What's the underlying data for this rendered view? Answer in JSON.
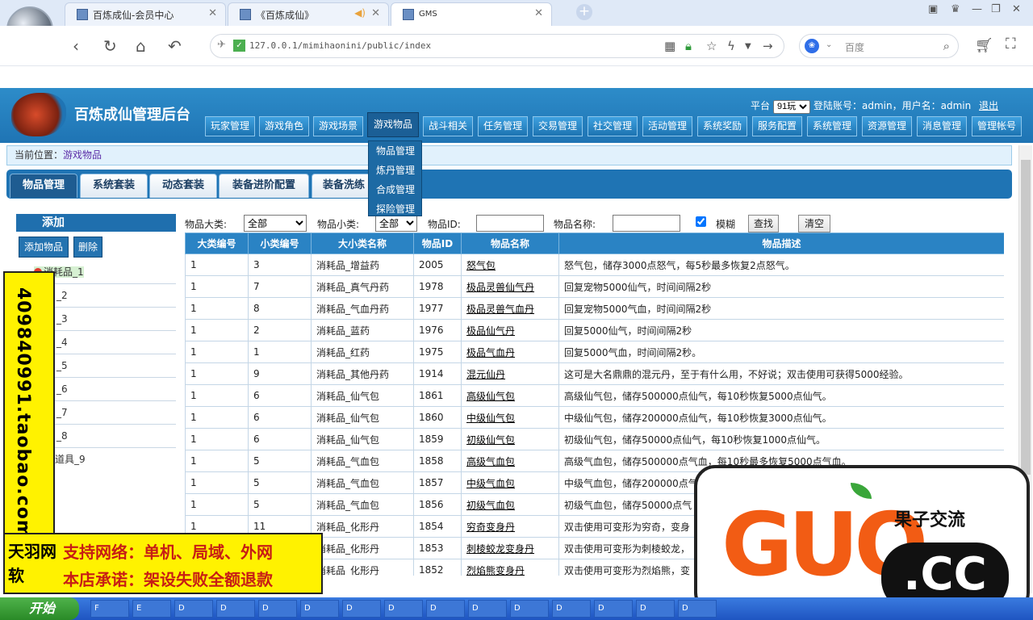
{
  "browser": {
    "tabs": [
      {
        "title": "百炼成仙-会员中心",
        "active": false
      },
      {
        "title": "《百炼成仙》",
        "active": false
      },
      {
        "title": "GMS",
        "active": true
      }
    ],
    "url": "127.0.0.1/mimihaonini/public/index",
    "search_engine": "百度"
  },
  "header": {
    "title": "百炼成仙管理后台",
    "platform_label": "平台",
    "platform_value": "91玩",
    "account_text": "登陆账号：admin，用户名：admin",
    "logout": "退出"
  },
  "menu": [
    "玩家管理",
    "游戏角色",
    "游戏场景",
    "游戏物品",
    "战斗相关",
    "任务管理",
    "交易管理",
    "社交管理",
    "活动管理",
    "系统奖励",
    "服务配置",
    "系统管理",
    "资源管理",
    "消息管理",
    "管理帐号"
  ],
  "dropdown": [
    "物品管理",
    "炼丹管理",
    "合成管理",
    "探险管理"
  ],
  "breadcrumb": {
    "label": "当前位置：",
    "value": "游戏物品"
  },
  "page_tabs": [
    "物品管理",
    "系统套装",
    "动态套装",
    "装备进阶配置",
    "装备洗练"
  ],
  "left_panel": {
    "title": "添加",
    "add_button": "添加物品",
    "delete_button": "删除",
    "items": [
      "消耗品_1",
      "_2",
      "_3",
      "_4",
      "_5",
      "_6",
      "_7",
      "_8",
      "道具_9"
    ]
  },
  "filter": {
    "category_label": "物品大类:",
    "category_value": "全部",
    "subcategory_label": "物品小类:",
    "subcategory_value": "全部",
    "id_label": "物品ID:",
    "name_label": "物品名称:",
    "fuzzy_label": "模糊",
    "search_button": "查找",
    "clear_button": "清空"
  },
  "table": {
    "columns": [
      "大类编号",
      "小类编号",
      "大小类名称",
      "物品ID",
      "物品名称",
      "物品描述"
    ],
    "rows": [
      [
        "1",
        "3",
        "消耗品_增益药",
        "2005",
        "怒气包",
        "怒气包，储存3000点怒气，每5秒最多恢复2点怒气。"
      ],
      [
        "1",
        "7",
        "消耗品_真气丹药",
        "1978",
        "极品灵兽仙气丹",
        "回复宠物5000仙气，时间间隔2秒"
      ],
      [
        "1",
        "8",
        "消耗品_气血丹药",
        "1977",
        "极品灵兽气血丹",
        "回复宠物5000气血，时间间隔2秒"
      ],
      [
        "1",
        "2",
        "消耗品_蓝药",
        "1976",
        "极品仙气丹",
        "回复5000仙气，时间间隔2秒"
      ],
      [
        "1",
        "1",
        "消耗品_红药",
        "1975",
        "极品气血丹",
        "回复5000气血，时间间隔2秒。"
      ],
      [
        "1",
        "9",
        "消耗品_其他丹药",
        "1914",
        "混元仙丹",
        "这可是大名鼎鼎的混元丹，至于有什么用，不好说；双击使用可获得5000经验。"
      ],
      [
        "1",
        "6",
        "消耗品_仙气包",
        "1861",
        "高级仙气包",
        "高级仙气包，储存500000点仙气，每10秒恢复5000点仙气。"
      ],
      [
        "1",
        "6",
        "消耗品_仙气包",
        "1860",
        "中级仙气包",
        "中级仙气包，储存200000点仙气，每10秒恢复3000点仙气。"
      ],
      [
        "1",
        "6",
        "消耗品_仙气包",
        "1859",
        "初级仙气包",
        "初级仙气包，储存50000点仙气，每10秒恢复1000点仙气。"
      ],
      [
        "1",
        "5",
        "消耗品_气血包",
        "1858",
        "高级气血包",
        "高级气血包，储存500000点气血，每10秒最多恢复5000点气血。"
      ],
      [
        "1",
        "5",
        "消耗品_气血包",
        "1857",
        "中级气血包",
        "中级气血包，储存200000点气"
      ],
      [
        "1",
        "5",
        "消耗品_气血包",
        "1856",
        "初级气血包",
        "初级气血包，储存50000点气"
      ],
      [
        "1",
        "11",
        "消耗品_化形丹",
        "1854",
        "穷奇变身丹",
        "双击使用可变形为穷奇，变身"
      ],
      [
        "1",
        "11",
        "消耗品_化形丹",
        "1853",
        "刺棱蛟龙变身丹",
        "双击使用可变形为刺棱蛟龙，"
      ],
      [
        "1",
        "11",
        "消耗品_化形丹",
        "1852",
        "烈焰熊变身丹",
        "双击使用可变形为烈焰熊，变"
      ]
    ]
  },
  "overlay": {
    "side_text": "409840991.taobao.com",
    "brand": "天羽网软",
    "line1": "支持网络：单机、局域、外网",
    "line2": "本店承诺：架设失败全额退款",
    "watermark_big": "GUO",
    "watermark_cc": ".CC",
    "watermark_cn": "果子交流"
  },
  "taskbar": {
    "start": "开始",
    "items": [
      "F",
      "E",
      "D",
      "D",
      "D",
      "D",
      "D",
      "D",
      "D",
      "D",
      "D",
      "D",
      "D",
      "D",
      "D"
    ]
  }
}
